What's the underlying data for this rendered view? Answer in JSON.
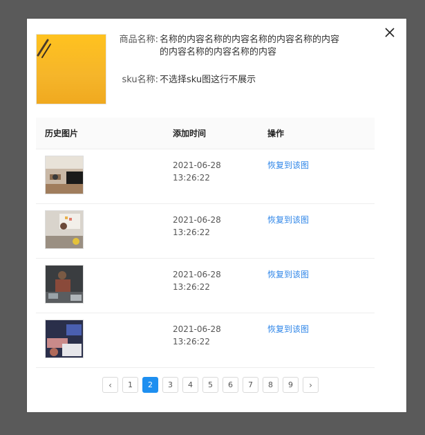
{
  "modal": {
    "close_icon": "close-icon",
    "product": {
      "name_label": "商品名称:",
      "name_value_line1": "名称的内容名称的内容名称的内容名称的内容",
      "name_value_line2": "的内容名称的内容名称的内容",
      "sku_label": "sku名称:",
      "sku_value": "不选择sku图这行不展示"
    },
    "table": {
      "headers": [
        "历史图片",
        "添加时间",
        "操作"
      ],
      "rows": [
        {
          "date": "2021-06-28",
          "time": "13:26:22",
          "action": "恢复到该图"
        },
        {
          "date": "2021-06-28",
          "time": "13:26:22",
          "action": "恢复到该图"
        },
        {
          "date": "2021-06-28",
          "time": "13:26:22",
          "action": "恢复到该图"
        },
        {
          "date": "2021-06-28",
          "time": "13:26:22",
          "action": "恢复到该图"
        }
      ]
    },
    "pagination": {
      "prev": "‹",
      "next": "›",
      "pages": [
        "1",
        "2",
        "3",
        "4",
        "5",
        "6",
        "7",
        "8",
        "9"
      ],
      "current": "2"
    }
  },
  "colors": {
    "accent": "#1e8ff0",
    "link": "#2f86e8",
    "overlay": "#5a5a5a"
  }
}
